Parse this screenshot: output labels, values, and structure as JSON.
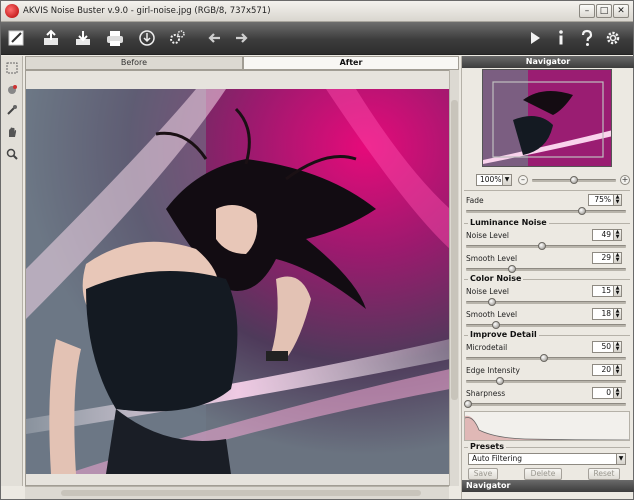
{
  "window": {
    "title": "AKVIS Noise Buster v.9.0 - girl-noise.jpg (RGB/8, 737x571)"
  },
  "toolbar": {
    "buttons": [
      {
        "name": "open-icon"
      },
      {
        "name": "export-icon"
      },
      {
        "name": "save-icon"
      },
      {
        "name": "print-icon"
      },
      {
        "name": "share-icon"
      },
      {
        "name": "batch-icon"
      },
      {
        "name": "undo-icon"
      },
      {
        "name": "redo-icon"
      },
      {
        "name": "run-icon"
      },
      {
        "name": "info-icon"
      },
      {
        "name": "help-icon"
      },
      {
        "name": "preferences-icon"
      }
    ]
  },
  "tools": [
    "preview-window-icon",
    "hand-settings-icon",
    "eyedropper-icon",
    "hand-icon",
    "zoom-icon"
  ],
  "tabs": {
    "before": "Before",
    "after": "After"
  },
  "panel": {
    "navigator_title": "Navigator",
    "zoom": "100%",
    "fade_label": "Fade",
    "fade_value": "75%",
    "luminance_title": "Luminance Noise",
    "luminance": {
      "noise_level_label": "Noise Level",
      "noise_level_value": "49",
      "smooth_level_label": "Smooth Level",
      "smooth_level_value": "29"
    },
    "color_title": "Color Noise",
    "color": {
      "noise_level_label": "Noise Level",
      "noise_level_value": "15",
      "smooth_level_label": "Smooth Level",
      "smooth_level_value": "18"
    },
    "detail_title": "Improve Detail",
    "detail": {
      "microdetail_label": "Microdetail",
      "microdetail_value": "50",
      "edge_label": "Edge Intensity",
      "edge_value": "20",
      "sharpness_label": "Sharpness",
      "sharpness_value": "0"
    },
    "presets_title": "Presets",
    "preset_selected": "Auto Filtering",
    "save_label": "Save",
    "delete_label": "Delete",
    "reset_label": "Reset",
    "footer_title": "Navigator"
  },
  "colors": {
    "toolbar_dark": "#3c3c3c",
    "magenta": "#d0107a",
    "panel_bg": "#ece9e2"
  }
}
